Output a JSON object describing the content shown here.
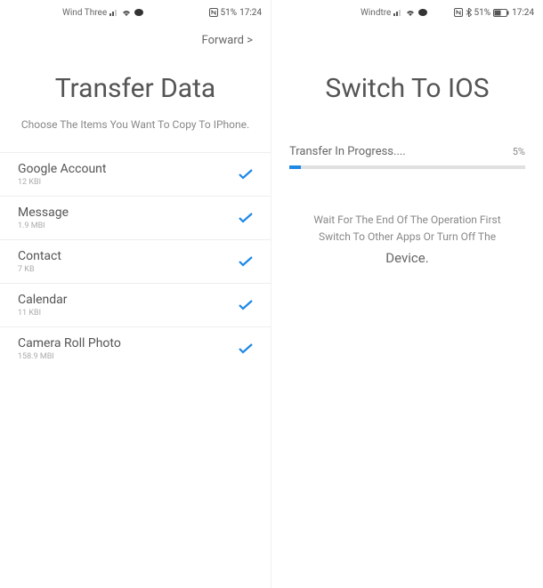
{
  "left": {
    "status": {
      "carrier": "Wind Three",
      "battery_pct": "51%",
      "time": "17:24"
    },
    "nav": {
      "forward": "Forward >"
    },
    "title": "Transfer Data",
    "subtitle": "Choose The Items You Want To Copy To IPhone.",
    "items": [
      {
        "label": "Google Account",
        "size": "12 KBI"
      },
      {
        "label": "Message",
        "size": "1.9 MBI"
      },
      {
        "label": "Contact",
        "size": "7 KB"
      },
      {
        "label": "Calendar",
        "size": "11 KBI"
      },
      {
        "label": "Camera Roll Photo",
        "size": "158.9 MBI"
      }
    ]
  },
  "right": {
    "status": {
      "carrier": "Windtre",
      "battery_pct": "51%",
      "time": "17:24"
    },
    "title": "Switch To IOS",
    "progress": {
      "label": "Transfer In Progress....",
      "pct_text": "5%",
      "pct_value": 5
    },
    "wait_line1": "Wait For The End Of The Operation First",
    "wait_line2": "Switch To Other Apps Or Turn Off The",
    "wait_line3": "Device."
  }
}
